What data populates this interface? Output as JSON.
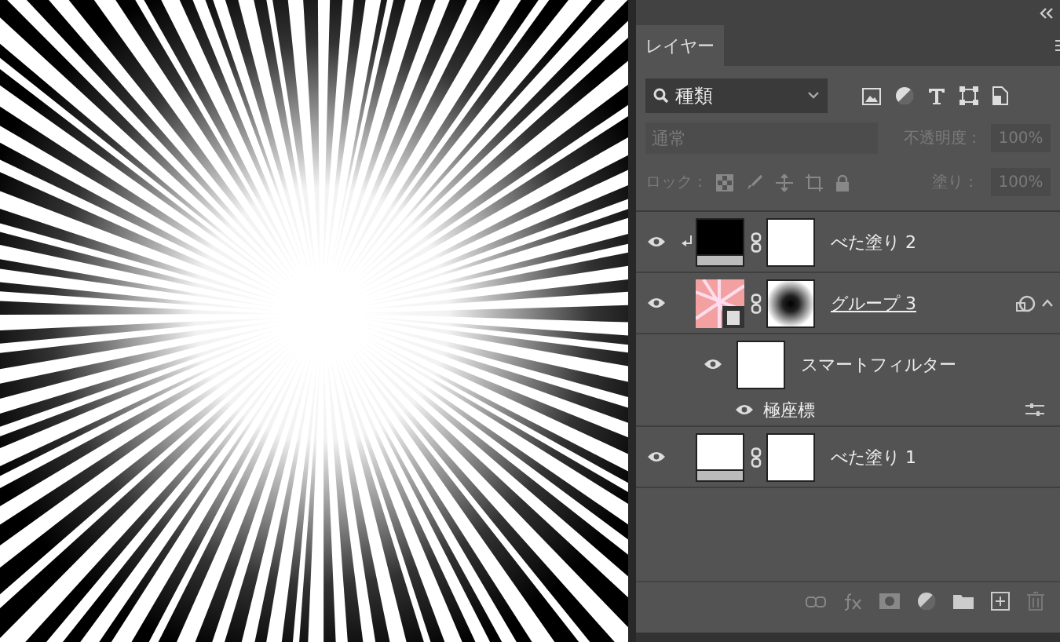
{
  "tab": {
    "label": "レイヤー",
    "selected": true
  },
  "filter": {
    "value": "種類"
  },
  "blend_mode": {
    "value": "通常",
    "disabled": true
  },
  "opacity": {
    "label": "不透明度 :",
    "value": "100%",
    "disabled": true
  },
  "lock": {
    "label": "ロック :"
  },
  "fill": {
    "label": "塗り :",
    "value": "100%",
    "disabled": true
  },
  "layers": [
    {
      "kind": "fill",
      "name": "べた塗り 2",
      "visible": true,
      "clipped": true,
      "color": "#000000"
    },
    {
      "kind": "smart",
      "name": "グループ 3",
      "visible": true,
      "expanded": true,
      "children": [
        {
          "kind": "filter_group",
          "name": "スマートフィルター",
          "visible": true
        },
        {
          "kind": "filter",
          "name": "極座標",
          "visible": true
        }
      ]
    },
    {
      "kind": "fill",
      "name": "べた塗り 1",
      "visible": true,
      "clipped": false,
      "color": "#ffffff"
    }
  ]
}
